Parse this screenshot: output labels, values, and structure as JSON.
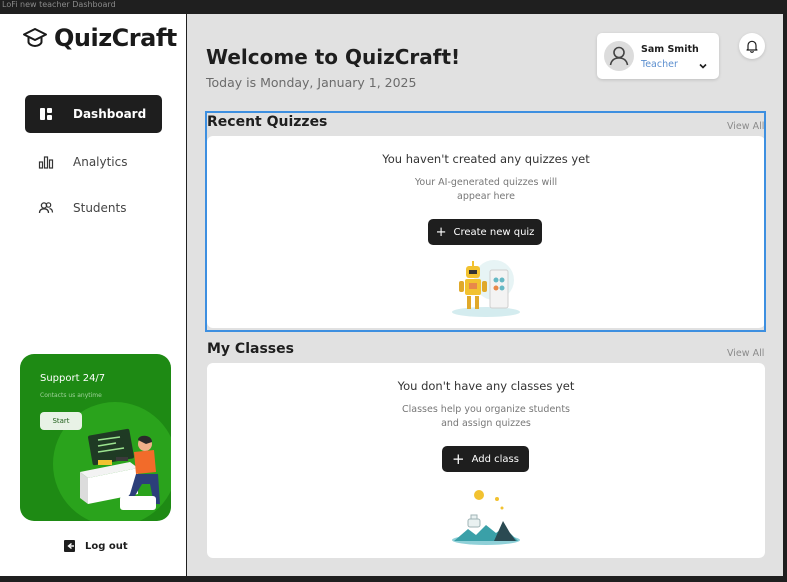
{
  "window": {
    "title": "LoFi new teacher Dashboard"
  },
  "brand": {
    "name": "QuizCraft"
  },
  "nav": {
    "items": [
      {
        "label": "Dashboard",
        "icon": "dashboard-icon",
        "active": true
      },
      {
        "label": "Analytics",
        "icon": "bar-chart-icon",
        "active": false
      },
      {
        "label": "Students",
        "icon": "users-icon",
        "active": false
      }
    ]
  },
  "support": {
    "title": "Support 24/7",
    "subtitle": "Contacts us anytime",
    "button": "Start"
  },
  "logout": {
    "label": "Log out"
  },
  "header": {
    "welcome": "Welcome to QuizCraft!",
    "date": "Today is Monday, January 1, 2025"
  },
  "user": {
    "name": "Sam Smith",
    "role": "Teacher"
  },
  "recent_quizzes": {
    "title": "Recent Quizzes",
    "view_all": "View All",
    "empty_title": "You haven't created any quizzes yet",
    "empty_line1": "Your AI-generated quizzes will",
    "empty_line2": "appear here",
    "button": "Create new quiz"
  },
  "my_classes": {
    "title": "My Classes",
    "view_all": "View All",
    "empty_title": "You don't have any classes yet",
    "empty_line1": "Classes help you organize students",
    "empty_line2": "and assign quizzes",
    "button": "Add class"
  },
  "colors": {
    "accent_dark": "#1e1e1e",
    "support_green": "#1e8a14",
    "selection_blue": "#3d8fe0",
    "role_blue": "#5c8fcf"
  }
}
